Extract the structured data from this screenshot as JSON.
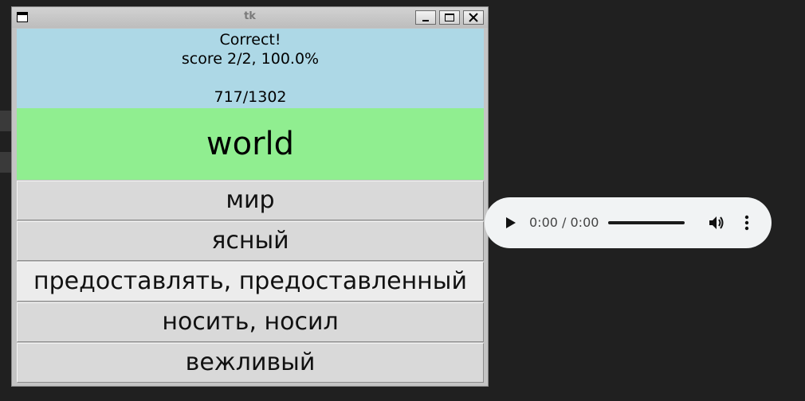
{
  "window": {
    "title": "tk"
  },
  "status": {
    "result": "Correct!",
    "score": "score 2/2, 100.0%",
    "progress": "717/1302"
  },
  "question": {
    "word": "world",
    "highlight_color": "#90ee90",
    "info_color": "#add8e6"
  },
  "choices": [
    {
      "label": "мир"
    },
    {
      "label": "ясный"
    },
    {
      "label": "предоставлять, предоставленный"
    },
    {
      "label": "носить, носил"
    },
    {
      "label": "вежливый"
    }
  ],
  "audio_player": {
    "time": "0:00 / 0:00",
    "play_icon": "play-icon",
    "volume_icon": "volume-icon",
    "more_icon": "more-options-icon"
  }
}
